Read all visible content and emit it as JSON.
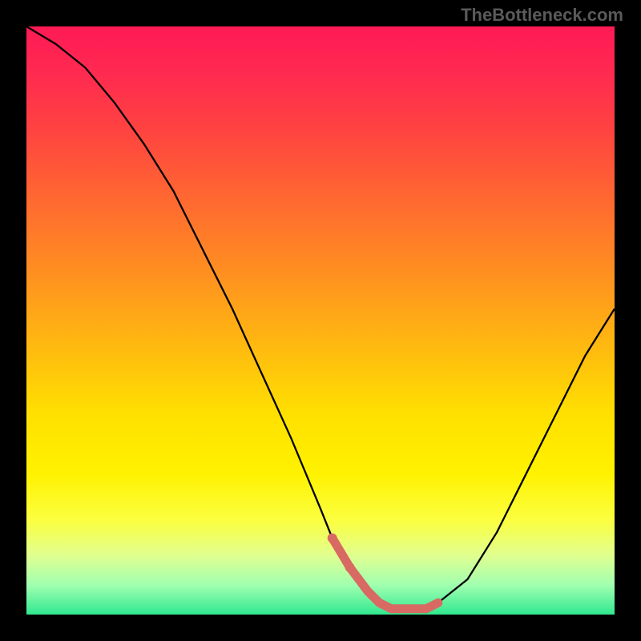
{
  "watermark": "TheBottleneck.com",
  "chart_data": {
    "type": "line",
    "title": "",
    "xlabel": "",
    "ylabel": "",
    "xlim": [
      0,
      100
    ],
    "ylim": [
      0,
      100
    ],
    "grid": false,
    "series": [
      {
        "name": "bottleneck-curve",
        "color": "#000000",
        "x": [
          0,
          5,
          10,
          15,
          20,
          25,
          30,
          35,
          40,
          45,
          50,
          52,
          55,
          58,
          60,
          62,
          65,
          68,
          70,
          75,
          80,
          85,
          90,
          95,
          100
        ],
        "values": [
          100,
          97,
          93,
          87,
          80,
          72,
          62,
          52,
          41,
          30,
          18,
          13,
          8,
          4,
          2,
          1,
          1,
          1,
          2,
          6,
          14,
          24,
          34,
          44,
          52
        ]
      },
      {
        "name": "highlight-segment",
        "color": "#d86a63",
        "x": [
          52,
          55,
          58,
          60,
          62,
          65,
          68,
          70
        ],
        "values": [
          13,
          8,
          4,
          2,
          1,
          1,
          1,
          2
        ]
      }
    ]
  }
}
